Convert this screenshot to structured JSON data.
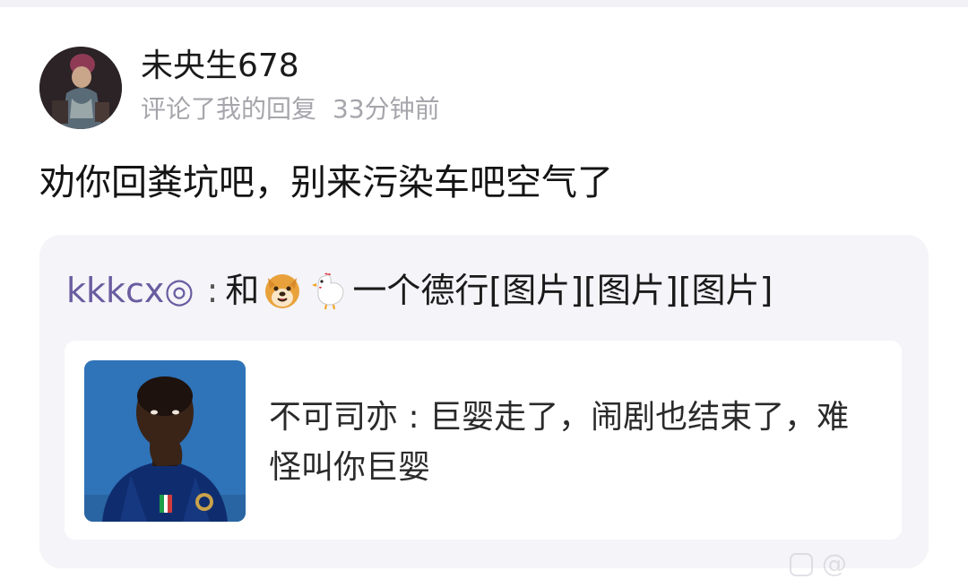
{
  "notification": {
    "user": {
      "name": "未央生678",
      "action": "评论了我的回复",
      "time": "33分钟前"
    },
    "comment_text": "劝你回粪坑吧，别来污染车吧空气了",
    "quoted_reply": {
      "author": "kkkcx◎",
      "separator": ":",
      "text_before_emoji": "和",
      "emojis": [
        "dog-face-emoji",
        "chicken-emoji"
      ],
      "text_after_emoji": "一个德行[图片][图片][图片]",
      "original_post": {
        "author": "不可司亦",
        "separator": ":",
        "text": "巨婴走了，闹剧也结束了，难怪叫你巨婴"
      }
    }
  },
  "watermark": "@"
}
